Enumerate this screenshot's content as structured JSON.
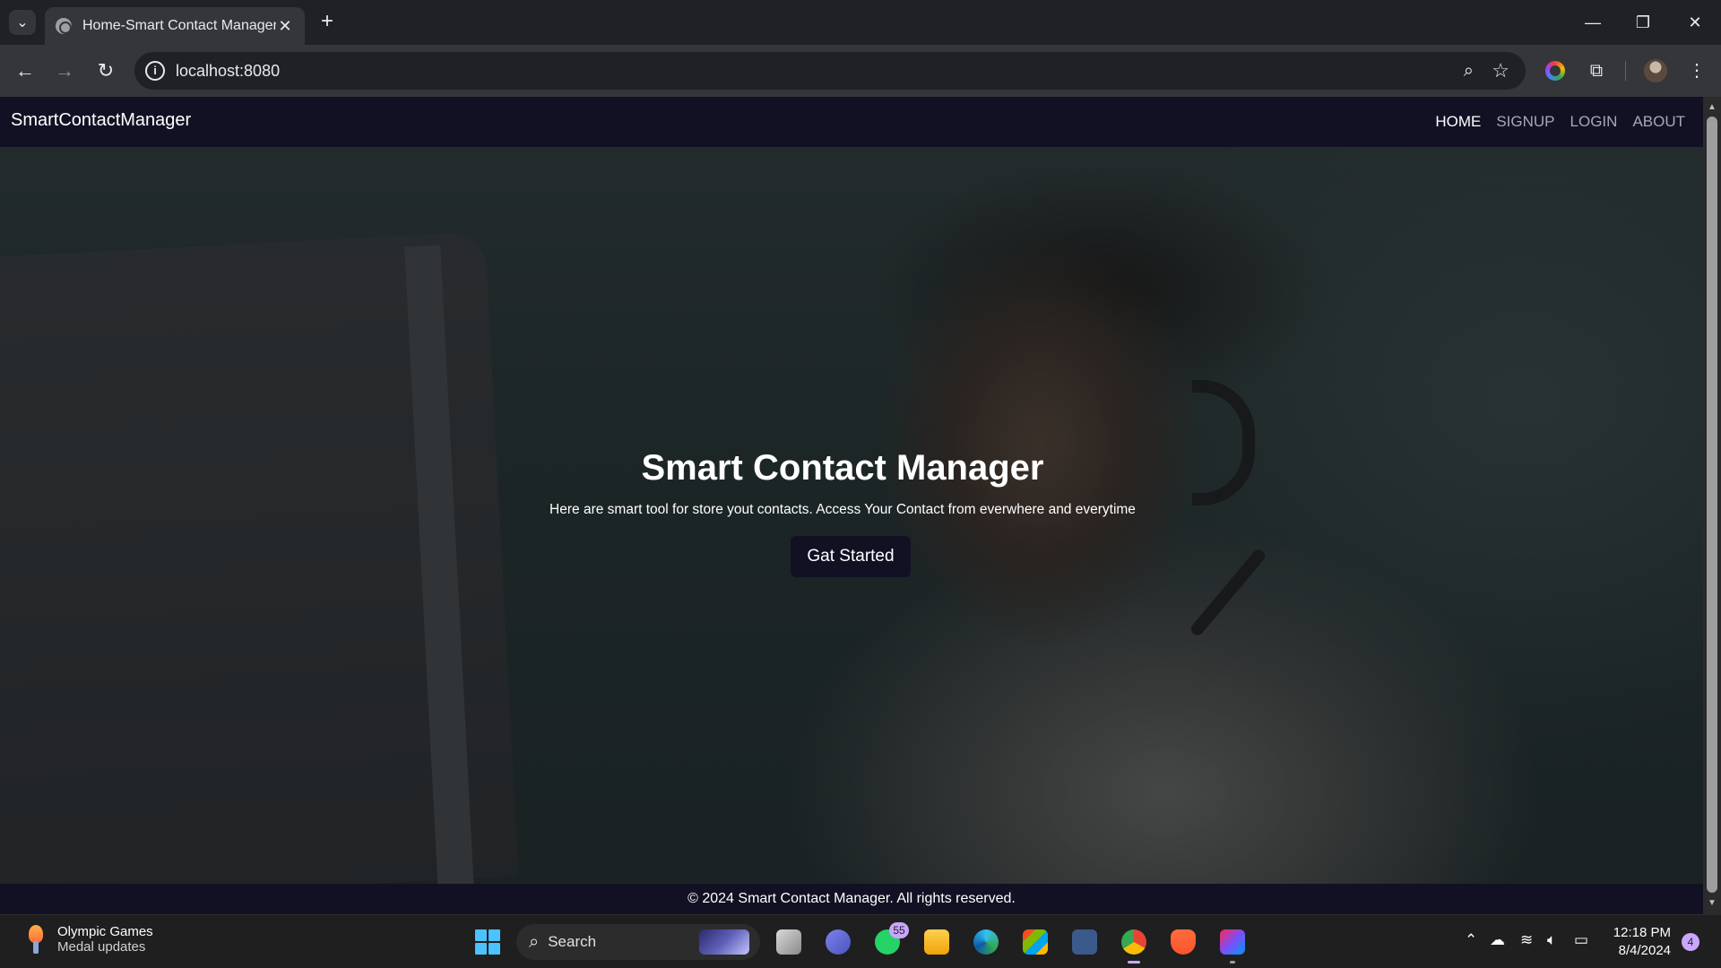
{
  "browser": {
    "tab_title": "Home-Smart Contact Manager",
    "tab_close": "✕",
    "new_tab": "+",
    "url": "localhost:8080",
    "window_controls": {
      "minimize": "—",
      "restore": "❐",
      "close": "✕"
    }
  },
  "site": {
    "brand": "SmartContactManager",
    "nav": {
      "home": "HOME",
      "signup": "SIGNUP",
      "login": "LOGIN",
      "about": "ABOUT"
    },
    "active_nav": "HOME"
  },
  "hero": {
    "title": "Smart Contact Manager",
    "subtitle": "Here are smart tool for store yout contacts. Access Your Contact from everwhere and everytime",
    "button": "Gat Started"
  },
  "footer": {
    "text": "© 2024 Smart Contact Manager. All rights reserved."
  },
  "taskbar": {
    "widget_title": "Olympic Games",
    "widget_subtitle": "Medal updates",
    "search_label": "Search",
    "whatsapp_badge": "55",
    "time": "12:18 PM",
    "date": "8/4/2024",
    "notification_count": "4"
  },
  "colors": {
    "site_nav_bg": "#121124",
    "accent_start": "#4cc2ff",
    "badge": "#c9a6ff"
  }
}
